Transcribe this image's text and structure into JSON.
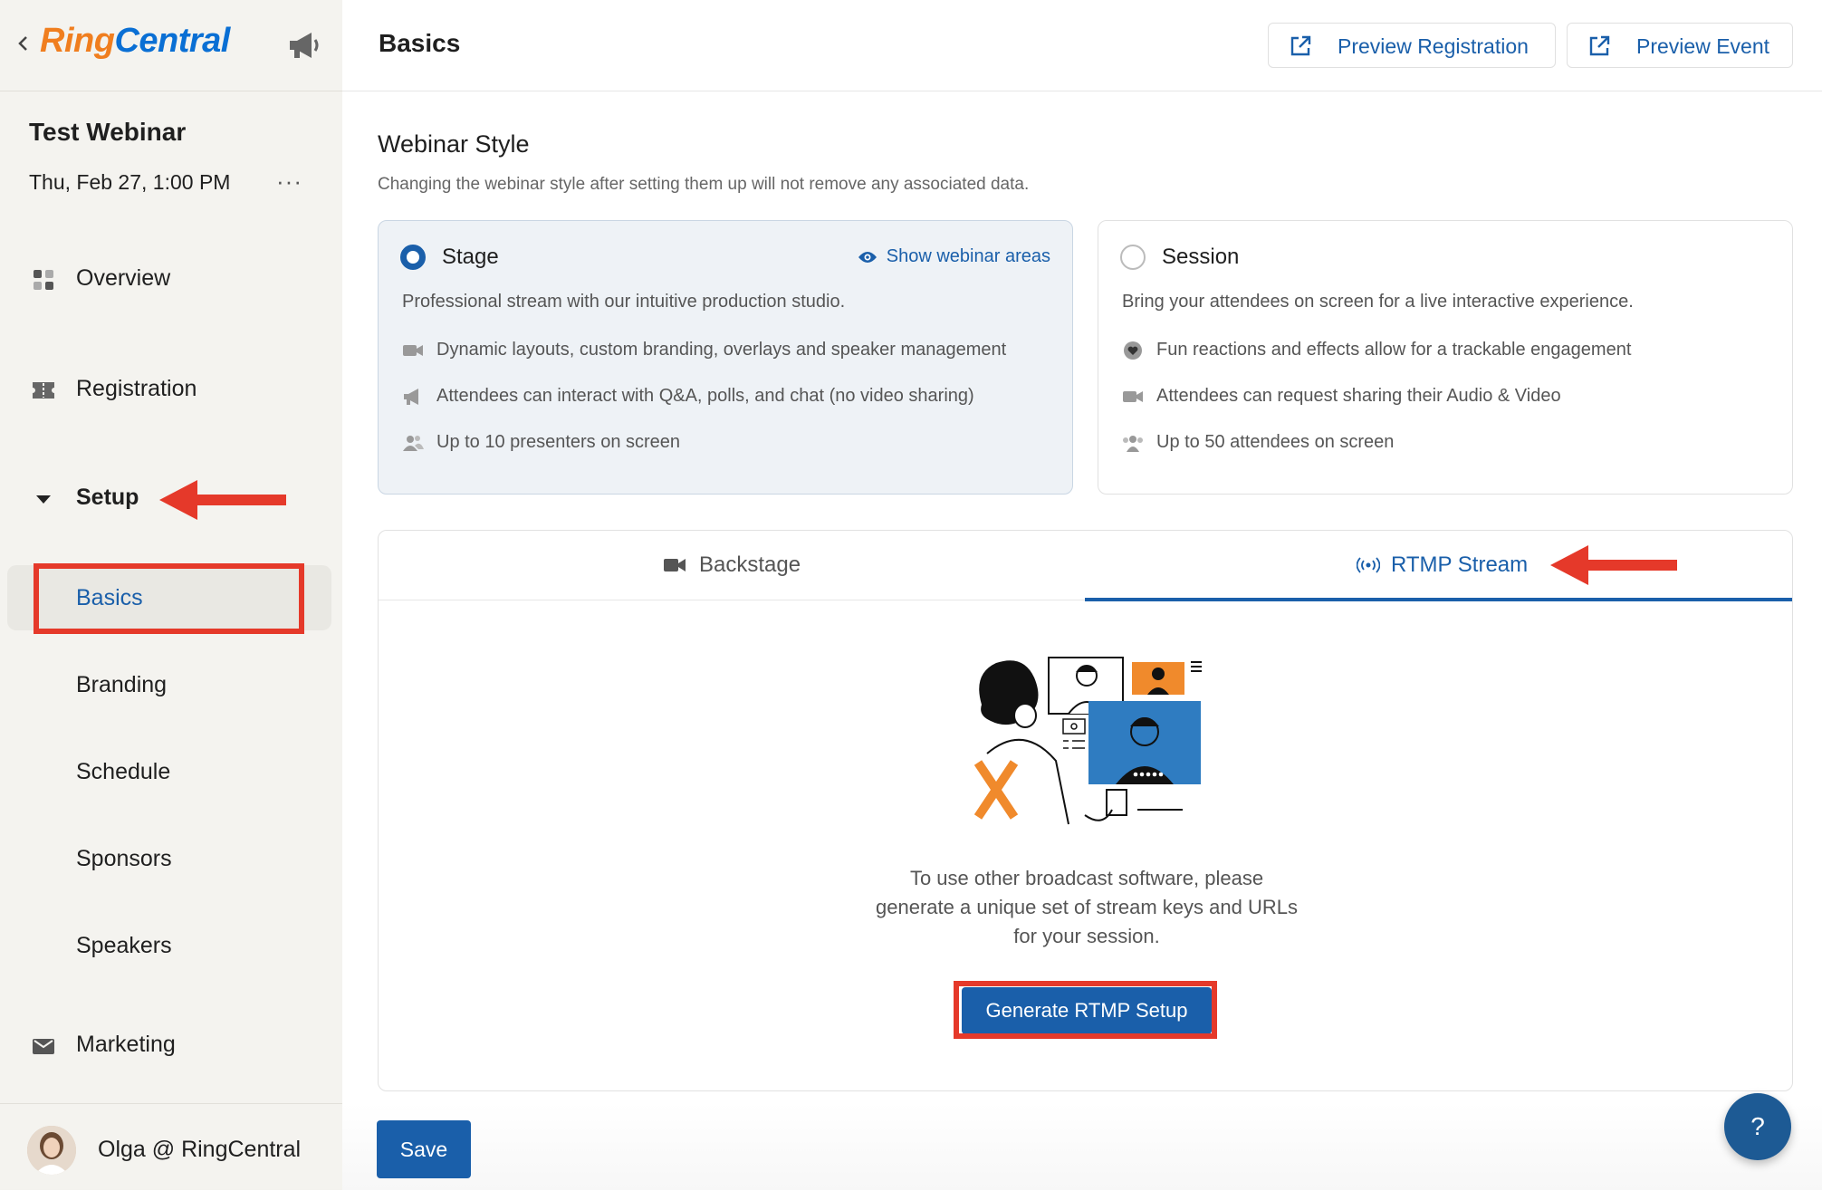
{
  "sidebar": {
    "logo": {
      "part1": "Ring",
      "part2": "Central"
    },
    "event_title": "Test Webinar",
    "event_date": "Thu, Feb 27, 1:00 PM",
    "more": "···",
    "nav": {
      "overview": "Overview",
      "registration": "Registration",
      "setup": "Setup",
      "marketing": "Marketing"
    },
    "setup_items": {
      "basics": "Basics",
      "branding": "Branding",
      "schedule": "Schedule",
      "sponsors": "Sponsors",
      "speakers": "Speakers"
    },
    "user_name": "Olga @ RingCentral"
  },
  "header": {
    "title": "Basics",
    "preview_registration": "Preview Registration",
    "preview_event": "Preview Event"
  },
  "webinar_style": {
    "title": "Webinar Style",
    "subtitle": "Changing the webinar style after setting them up will not remove any associated data.",
    "stage": {
      "title": "Stage",
      "show_areas": "Show webinar areas",
      "description": "Professional stream with our intuitive production studio.",
      "features": [
        "Dynamic layouts, custom branding, overlays and speaker management",
        "Attendees can interact with Q&A, polls, and chat (no video sharing)",
        "Up to 10 presenters on screen"
      ]
    },
    "session": {
      "title": "Session",
      "description": "Bring your attendees on screen for a live interactive experience.",
      "features": [
        "Fun reactions and effects allow for a trackable engagement",
        "Attendees can request sharing their Audio & Video",
        "Up to 50 attendees on screen"
      ]
    }
  },
  "tabs": {
    "backstage": "Backstage",
    "rtmp": "RTMP Stream",
    "active": "RTMP Stream"
  },
  "rtmp": {
    "line1": "To use other broadcast software, please",
    "line2": "generate a unique set of stream keys and URLs",
    "line3": "for your session.",
    "button": "Generate RTMP Setup"
  },
  "footer": {
    "save": "Save",
    "help": "?"
  },
  "colors": {
    "accent": "#1a5faa",
    "annotation_red": "#e5392a",
    "logo_orange": "#f07e1f",
    "logo_blue": "#0a6fd4",
    "sidebar_bg": "#f4f3ef"
  }
}
